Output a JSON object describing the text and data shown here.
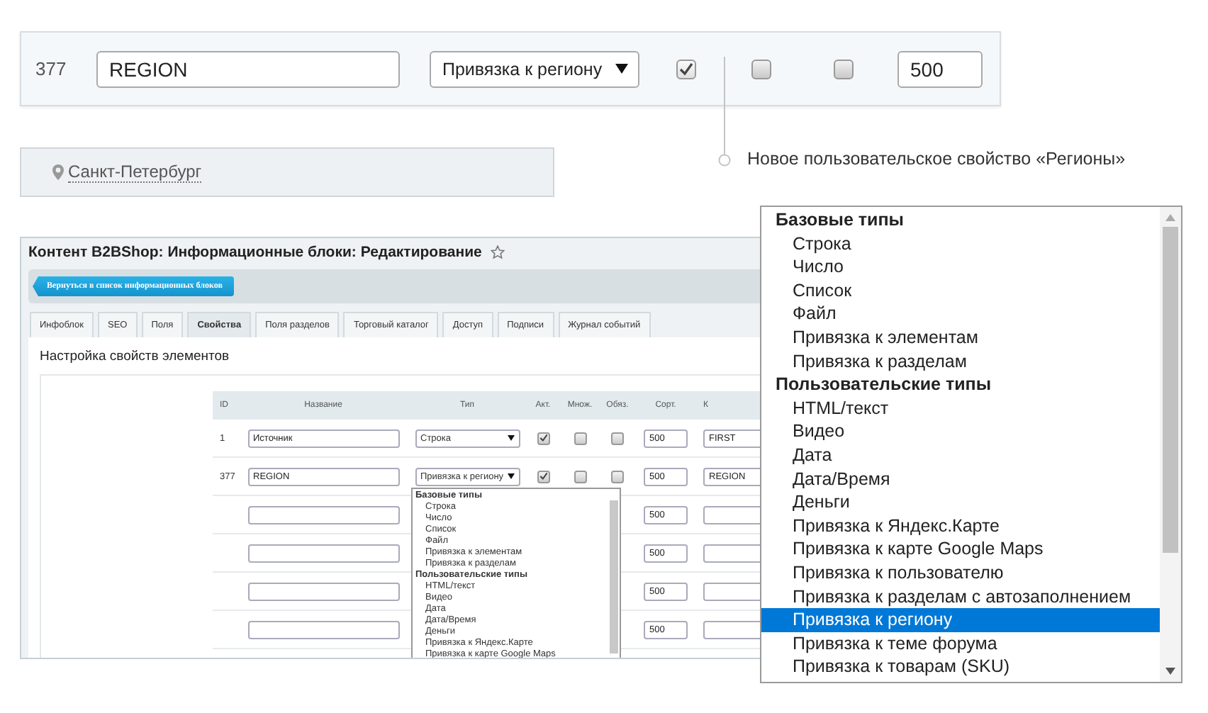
{
  "top_row": {
    "id": "377",
    "name": "REGION",
    "type": "Привязка к региону",
    "active": true,
    "multiple": false,
    "required": false,
    "sort": "500"
  },
  "location": {
    "city": "Санкт-Петербург"
  },
  "annotation": {
    "text": "Новое пользовательское свойство «Регионы»"
  },
  "admin": {
    "title": "Контент B2BShop: Информационные блоки: Редактирование",
    "back_button": "Вернуться в список информационных блоков",
    "tabs": [
      {
        "label": "Инфоблок",
        "selected": false
      },
      {
        "label": "SEO",
        "selected": false
      },
      {
        "label": "Поля",
        "selected": false
      },
      {
        "label": "Свойства",
        "selected": true
      },
      {
        "label": "Поля разделов",
        "selected": false
      },
      {
        "label": "Торговый каталог",
        "selected": false
      },
      {
        "label": "Доступ",
        "selected": false
      },
      {
        "label": "Подписи",
        "selected": false
      },
      {
        "label": "Журнал событий",
        "selected": false
      }
    ],
    "section_title": "Настройка свойств элементов",
    "table": {
      "columns": [
        "ID",
        "Название",
        "Тип",
        "Акт.",
        "Множ.",
        "Обяз.",
        "Сорт.",
        "К"
      ],
      "rows": [
        {
          "id": "1",
          "name": "Источник",
          "type": "Строка",
          "active": true,
          "multiple": false,
          "required": false,
          "sort": "500",
          "code": "FIRST"
        },
        {
          "id": "377",
          "name": "REGION",
          "type": "Привязка к региону",
          "active": true,
          "multiple": false,
          "required": false,
          "sort": "500",
          "code": "REGION"
        },
        {
          "sort": "500"
        },
        {
          "sort": "500"
        },
        {
          "sort": "500"
        },
        {
          "sort": "500"
        }
      ]
    },
    "type_dropdown": {
      "groups": [
        {
          "label": "Базовые типы",
          "options": [
            "Строка",
            "Число",
            "Список",
            "Файл",
            "Привязка к элементам",
            "Привязка к разделам"
          ]
        },
        {
          "label": "Пользовательские типы",
          "options": [
            "HTML/текст",
            "Видео",
            "Дата",
            "Дата/Время",
            "Деньги",
            "Привязка к Яндекс.Карте",
            "Привязка к карте Google Maps"
          ]
        }
      ]
    }
  },
  "type_menu": {
    "groups": [
      {
        "label": "Базовые типы",
        "options": [
          {
            "label": "Строка",
            "selected": false
          },
          {
            "label": "Число",
            "selected": false
          },
          {
            "label": "Список",
            "selected": false
          },
          {
            "label": "Файл",
            "selected": false
          },
          {
            "label": "Привязка к элементам",
            "selected": false
          },
          {
            "label": "Привязка к разделам",
            "selected": false
          }
        ]
      },
      {
        "label": "Пользовательские типы",
        "options": [
          {
            "label": "HTML/текст",
            "selected": false
          },
          {
            "label": "Видео",
            "selected": false
          },
          {
            "label": "Дата",
            "selected": false
          },
          {
            "label": "Дата/Время",
            "selected": false
          },
          {
            "label": "Деньги",
            "selected": false
          },
          {
            "label": "Привязка к Яндекс.Карте",
            "selected": false
          },
          {
            "label": "Привязка к карте Google Maps",
            "selected": false
          },
          {
            "label": "Привязка к пользователю",
            "selected": false
          },
          {
            "label": "Привязка к разделам с автозаполнением",
            "selected": false
          },
          {
            "label": "Привязка к региону",
            "selected": true
          },
          {
            "label": "Привязка к теме форума",
            "selected": false
          },
          {
            "label": "Привязка к товарам (SKU)",
            "selected": false
          }
        ]
      }
    ]
  }
}
